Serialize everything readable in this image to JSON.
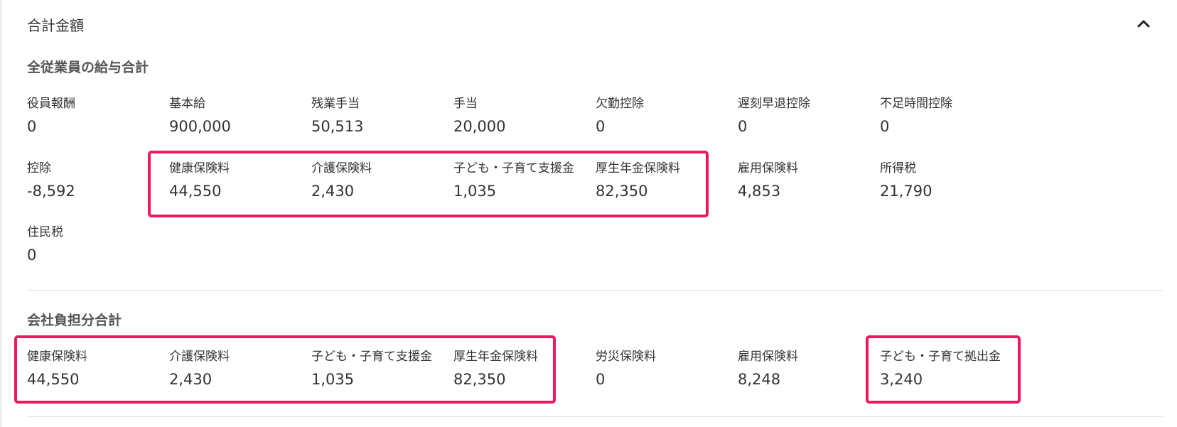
{
  "panel": {
    "title": "合計金額"
  },
  "employee_section": {
    "title": "全従業員の給与合計",
    "items": [
      {
        "label": "役員報酬",
        "value": "0"
      },
      {
        "label": "基本給",
        "value": "900,000"
      },
      {
        "label": "残業手当",
        "value": "50,513"
      },
      {
        "label": "手当",
        "value": "20,000"
      },
      {
        "label": "欠勤控除",
        "value": "0"
      },
      {
        "label": "遅刻早退控除",
        "value": "0"
      },
      {
        "label": "不足時間控除",
        "value": "0"
      },
      {
        "label": "控除",
        "value": "-8,592"
      },
      {
        "label": "健康保険料",
        "value": "44,550"
      },
      {
        "label": "介護保険料",
        "value": "2,430"
      },
      {
        "label": "子ども・子育て支援金",
        "value": "1,035"
      },
      {
        "label": "厚生年金保険料",
        "value": "82,350"
      },
      {
        "label": "雇用保険料",
        "value": "4,853"
      },
      {
        "label": "所得税",
        "value": "21,790"
      },
      {
        "label": "住民税",
        "value": "0"
      }
    ]
  },
  "company_section": {
    "title": "会社負担分合計",
    "items": [
      {
        "label": "健康保険料",
        "value": "44,550"
      },
      {
        "label": "介護保険料",
        "value": "2,430"
      },
      {
        "label": "子ども・子育て支援金",
        "value": "1,035"
      },
      {
        "label": "厚生年金保険料",
        "value": "82,350"
      },
      {
        "label": "労災保険料",
        "value": "0"
      },
      {
        "label": "雇用保険料",
        "value": "8,248"
      },
      {
        "label": "子ども・子育て拠出金",
        "value": "3,240"
      }
    ]
  },
  "colors": {
    "highlight": "#ee1763",
    "divider": "#e0e0e0"
  },
  "icons": {
    "collapse": "chevron-up-icon"
  }
}
